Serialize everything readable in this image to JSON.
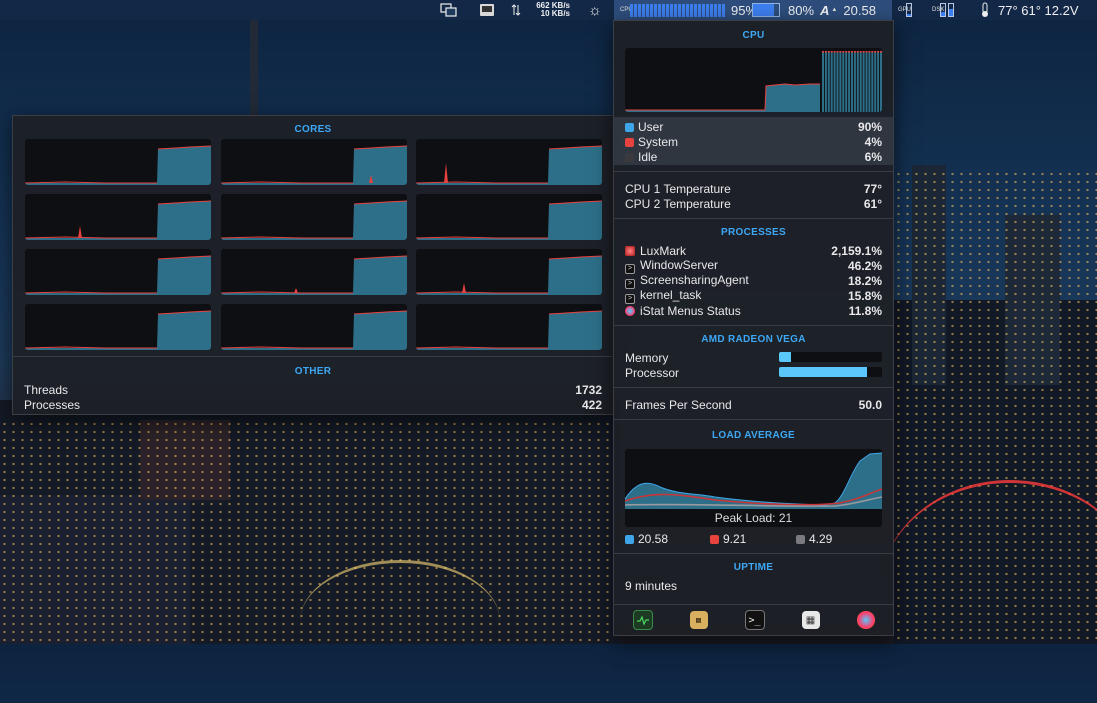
{
  "menubar": {
    "net_up": "662 KB/s",
    "net_down": "10 KB/s",
    "cpu_label": "CPU",
    "cpu_percent": "95%",
    "mem_percent": "80%",
    "load_avg": "20.58",
    "load_letter": "A",
    "gpu_label": "GPU",
    "disk_label": "DSK",
    "temps": "77° 61° 12.2V",
    "bars_fill": 0.95,
    "mem_fill": 0.8
  },
  "cores_panel": {
    "title": "CORES",
    "other_title": "OTHER",
    "threads_label": "Threads",
    "threads_value": "1732",
    "processes_label": "Processes",
    "processes_value": "422",
    "core_count": 12
  },
  "cpu_panel": {
    "title": "CPU",
    "user_label": "User",
    "user_value": "90%",
    "system_label": "System",
    "system_value": "4%",
    "idle_label": "Idle",
    "idle_value": "6%",
    "temp1_label": "CPU 1 Temperature",
    "temp1_value": "77°",
    "temp2_label": "CPU 2 Temperature",
    "temp2_value": "61°",
    "processes_title": "PROCESSES",
    "processes": [
      {
        "name": "LuxMark",
        "value": "2,159.1%",
        "icon": "luxmark-icon"
      },
      {
        "name": "WindowServer",
        "value": "46.2%",
        "icon": "terminal-icon"
      },
      {
        "name": "ScreensharingAgent",
        "value": "18.2%",
        "icon": "terminal-icon"
      },
      {
        "name": "kernel_task",
        "value": "15.8%",
        "icon": "terminal-icon"
      },
      {
        "name": "iStat Menus Status",
        "value": "11.8%",
        "icon": "istat-icon"
      }
    ],
    "gpu_title": "AMD RADEON VEGA",
    "gpu_memory_label": "Memory",
    "gpu_memory_fill": 0.12,
    "gpu_processor_label": "Processor",
    "gpu_processor_fill": 0.85,
    "fps_label": "Frames Per Second",
    "fps_value": "50.0",
    "load_title": "LOAD AVERAGE",
    "peak_label": "Peak Load: 21",
    "load1": "20.58",
    "load5": "9.21",
    "load15": "4.29",
    "uptime_title": "UPTIME",
    "uptime_value": "9 minutes"
  },
  "colors": {
    "accent": "#3da8f5",
    "user": "#3ea6e8",
    "system": "#e8423f",
    "idle": "#3a3a3e",
    "graph_fill": "#2d6f88"
  },
  "toolbar_icons": [
    "activity-monitor-icon",
    "console-icon",
    "terminal-icon",
    "system-info-icon",
    "istat-icon"
  ]
}
